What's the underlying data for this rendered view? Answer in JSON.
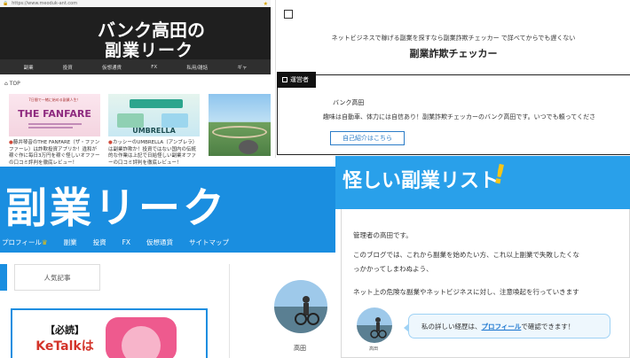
{
  "screenA": {
    "url": "https://www.meoduk-ant.com",
    "site_title_line1": "バンク高田の",
    "site_title_line2": "副業リーク",
    "nav": [
      "副業",
      "投資",
      "仮想通貨",
      "FX",
      "私用/雑話",
      "ギャ"
    ],
    "breadcrumb": "TOP",
    "cards": [
      {
        "title": "藤井琴音のTHE FANFARE（ザ・ファンファーレ）は詐欺投資アプリか！違和が稼ぐ作に毎日3万円を稼ぐ怪しいオファーの口コミ評判を徹底レビュー！",
        "thumb_caption": "THE FANFARE"
      },
      {
        "title": "カッシーのUMBRELLA（アンブレラ）は副業詐欺か！投資ではない国内の伝統的な作業は上記で日給怪しい副業オファーの口コミ評判を徹底レビュー！",
        "thumb_caption": "UMBRELLA"
      },
      {
        "title": "",
        "thumb_caption": ""
      }
    ]
  },
  "screenB": {
    "tagline": "ネットビジネスで稼げる副業を探すなら副業詐欺チェッカー で詳べてからでも遅くない",
    "title": "副業詐欺チェッカー",
    "admin_tab": "運営者",
    "admin_name": "バンク高田",
    "admin_desc": "趣味は自動車、体力には自信あり！副業詐欺チェッカーのバンク高田です。いつでも頼ってくださ",
    "intro_button": "自己紹介はこちら"
  },
  "screenC": {
    "banner": "副業リーク",
    "nav": [
      "プロフィール",
      "副業",
      "投資",
      "FX",
      "仮想通貨",
      "サイトマップ"
    ],
    "tab_popular": "人気記事",
    "post_line1": "【必読】",
    "post_line2": "KeTalkは",
    "author_name": "高田"
  },
  "screenD": {
    "title": "怪しい副業リスト",
    "exclaim": "!",
    "p1": "管理者の高田です。",
    "p2": "このブログでは、これから副業を始めたい方、これ以上副業で失敗したくな",
    "p3": "っかかってしまわぬよう、",
    "p4": "ネット上の危険な副業やネットビジネスに対し、注意喚起を行っていきます",
    "bubble_pre": "私の詳しい経歴は、",
    "bubble_link": "プロフィール",
    "bubble_post": "で確認できます！",
    "avatar_label": "高田"
  },
  "colors": {
    "dark_header": "#1f1f1f",
    "blue_banner": "#1a8ee0",
    "blue_banner_light": "#29a0ea",
    "link_blue": "#1a75cf",
    "accent_yellow": "#f5c518"
  }
}
